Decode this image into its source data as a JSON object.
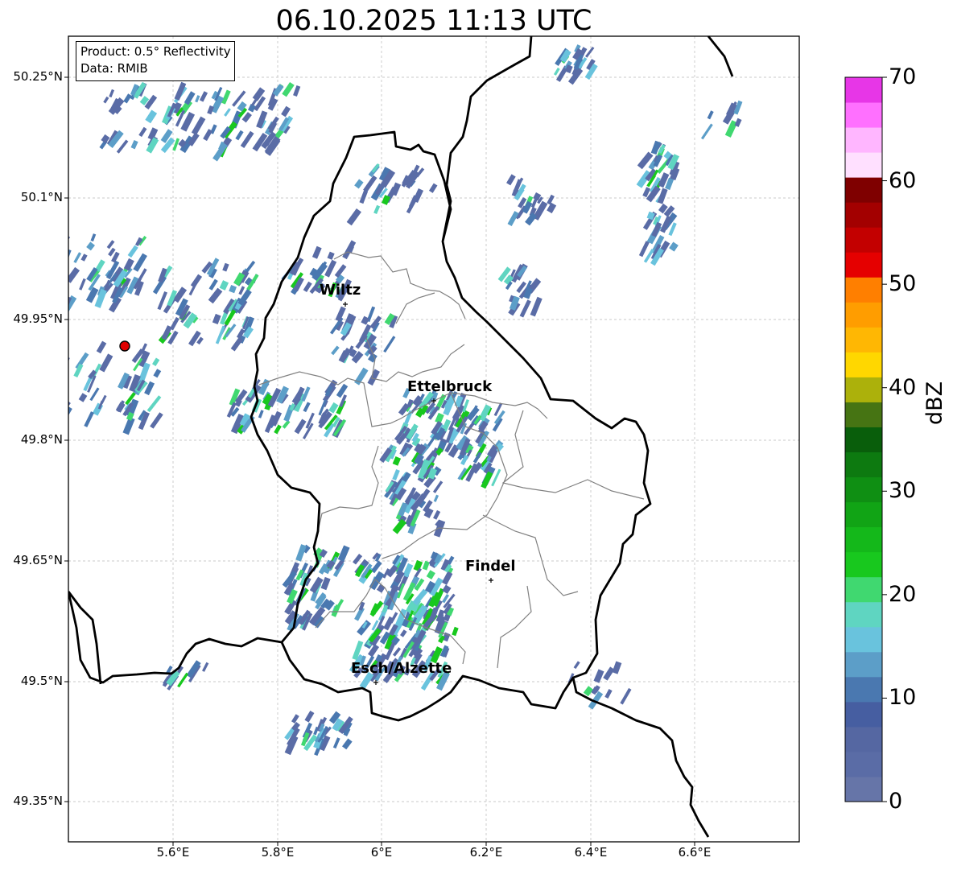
{
  "title": "06.10.2025 11:13 UTC",
  "info_box": {
    "line1": "Product: 0.5° Reflectivity",
    "line2": "Data: RMIB"
  },
  "latitude_labels": [
    "50.25°N",
    "50.1°N",
    "49.95°N",
    "49.8°N",
    "49.65°N",
    "49.5°N",
    "49.35°N"
  ],
  "longitude_labels": [
    "5.6°E",
    "5.8°E",
    "6°E",
    "6.2°E",
    "6.4°E",
    "6.6°E"
  ],
  "cities": [
    {
      "name": "Wiltz"
    },
    {
      "name": "Ettelbruck"
    },
    {
      "name": "Findel"
    },
    {
      "name": "Esch/Alzette"
    }
  ],
  "colorbar": {
    "label": "dBZ",
    "ticks": [
      "0",
      "10",
      "20",
      "30",
      "40",
      "50",
      "60",
      "70"
    ],
    "colors": [
      "#6675a8",
      "#5a6ca6",
      "#5567a2",
      "#465ea1",
      "#4a78b0",
      "#5c9ec8",
      "#69c3dd",
      "#5fd5c1",
      "#40d870",
      "#18c81e",
      "#14b81a",
      "#11a415",
      "#0f8f13",
      "#0d7a10",
      "#095e0b",
      "#467413",
      "#acb10b",
      "#ffd700",
      "#ffb703",
      "#ff9d00",
      "#ff7f00",
      "#e50000",
      "#c30000",
      "#a30000",
      "#7f0000",
      "#ffe0ff",
      "#ffb6ff",
      "#ff70ff",
      "#e736e7"
    ]
  },
  "radar_site_color": "#e00000"
}
